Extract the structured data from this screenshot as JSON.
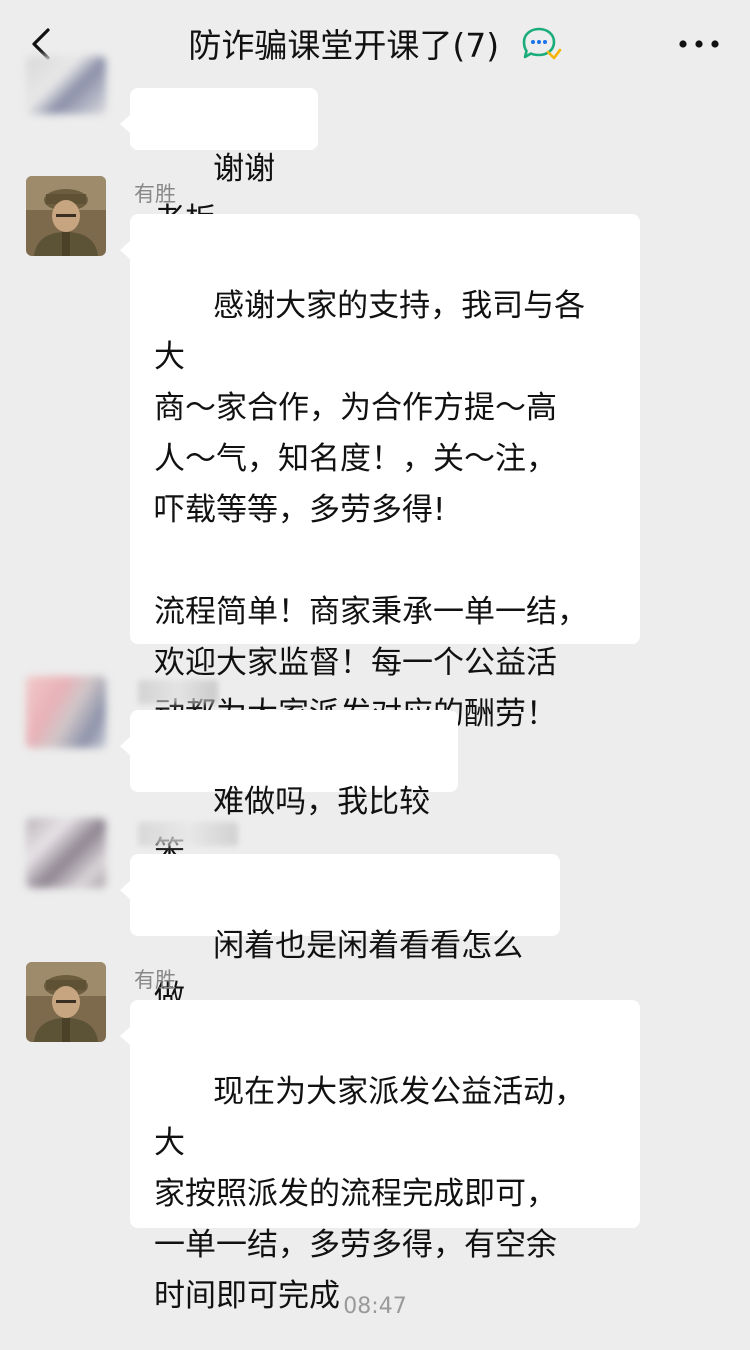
{
  "header": {
    "title": "防诈骗课堂开课了(7)",
    "back_icon": "chevron-left-icon",
    "group_icon": "group-chat-icon",
    "more_icon": "more-dots-icon"
  },
  "messages": [
    {
      "sender": "",
      "avatar_icon": "blurred-avatar",
      "text": "谢谢老板"
    },
    {
      "sender": "有胜",
      "avatar_icon": "soldier-avatar",
      "text": "感谢大家的支持，我司与各大\n商～家合作，为合作方提～高\n人～气，知名度！，关～注，\n吓载等等，多劳多得!\n\n流程简单！商家秉承一单一结，\n欢迎大家监督！每一个公益活\n动都为大家派发对应的酬劳！"
    },
    {
      "sender": "",
      "avatar_icon": "blurred-avatar",
      "text": "难做吗，我比较笨"
    },
    {
      "sender": "",
      "avatar_icon": "blurred-avatar",
      "text": "闲着也是闲着看看怎么做"
    },
    {
      "sender": "有胜",
      "avatar_icon": "soldier-avatar",
      "text": "现在为大家派发公益活动，大\n家按照派发的流程完成即可，\n一单一结，多劳多得，有空余\n时间即可完成"
    }
  ],
  "timestamp": "08:47",
  "colors": {
    "background": "#ededed",
    "bubble": "#ffffff",
    "text": "#111111",
    "sender": "#888888"
  }
}
